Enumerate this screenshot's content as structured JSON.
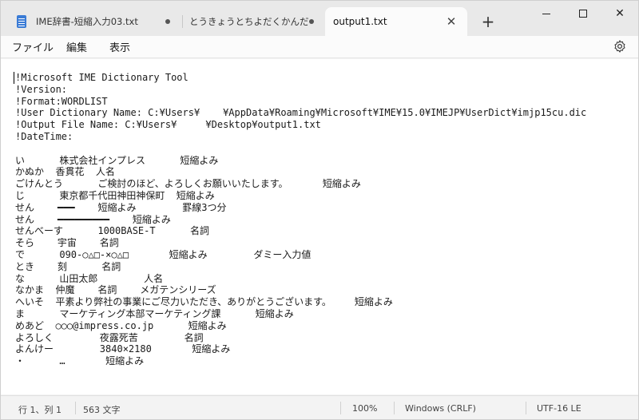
{
  "tabs": [
    {
      "label": "IME辞書-短縮入力03.txt",
      "modified": true
    },
    {
      "label": "とうきょうとちよだくかんだじんぼ",
      "modified": true
    },
    {
      "label": "output1.txt",
      "active": true
    }
  ],
  "menu": {
    "file": "ファイル",
    "edit": "編集",
    "view": "表示"
  },
  "window_controls": {
    "minimize": "—",
    "maximize": "☐",
    "close": "✕"
  },
  "new_tab": "+",
  "tab_close": "✕",
  "content_lines": [
    "!Microsoft IME Dictionary Tool",
    "!Version:",
    "!Format:WORDLIST",
    "!User Dictionary Name: C:¥Users¥    ¥AppData¥Roaming¥Microsoft¥IME¥15.0¥IMEJP¥UserDict¥imjp15cu.dic",
    "!Output File Name: C:¥Users¥     ¥Desktop¥output1.txt",
    "!DateTime:",
    "",
    "い      株式会社インプレス      短縮よみ",
    "かぬか  香貫花  人名",
    "ごけんとう      ご検討のほど、よろしくお願いいたします。      短縮よみ",
    "じ      東京都千代田神田神保町  短縮よみ",
    "せん    ━━━    短縮よみ        罫線3つ分",
    "せん    ━━━━━━━━━    短縮よみ",
    "せんべーす      1000BASE-T      名詞",
    "そら    宇宙    名詞",
    "で      090-○△□-×○△□       短縮よみ        ダミー入力値",
    "とき    刻      名詞",
    "な      山田太郎        人名",
    "なかま  仲魔    名詞    メガテンシリーズ",
    "へいそ  平素より弊社の事業にご尽力いただき、ありがとうございます。    短縮よみ",
    "ま      マーケティング本部マーケティング課      短縮よみ",
    "めあど  ○○○@impress.co.jp      短縮よみ",
    "よろしく        夜露死苦        名詞",
    "よんけー        3840×2180       短縮よみ",
    "・      …       短縮よみ"
  ],
  "status": {
    "position": "行 1、列 1",
    "chars": "563 文字",
    "zoom": "100%",
    "line_ending": "Windows (CRLF)",
    "encoding": "UTF-16 LE"
  }
}
